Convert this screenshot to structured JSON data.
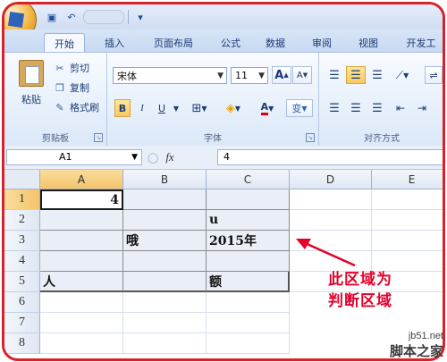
{
  "tabs": [
    "开始",
    "插入",
    "页面布局",
    "公式",
    "数据",
    "审阅",
    "视图",
    "开发工"
  ],
  "clipboard": {
    "paste": "粘贴",
    "cut": "剪切",
    "copy": "复制",
    "format_painter": "格式刷",
    "group_label": "剪贴板"
  },
  "font": {
    "name": "宋体",
    "size": "11",
    "grow": "A",
    "shrink": "A",
    "bold": "B",
    "italic": "I",
    "underline": "U",
    "font_color_glyph": "A",
    "phonetic": "变",
    "group_label": "字体"
  },
  "alignment": {
    "group_label": "对齐方式"
  },
  "formula_bar": {
    "name_box": "A1",
    "fx": "fx",
    "value": "4"
  },
  "columns": [
    "A",
    "B",
    "C",
    "D",
    "E"
  ],
  "rows": [
    "1",
    "2",
    "3",
    "4",
    "5",
    "6",
    "7",
    "8"
  ],
  "cells": {
    "A1": "4",
    "C2": "u",
    "B3": "哦",
    "C3": "2015年",
    "A5": "人",
    "C5": "额"
  },
  "annotation": {
    "line1": "此区域为",
    "line2": "判断区域",
    "color": "#e4002b"
  },
  "watermark": {
    "url": "jb51.net",
    "name": "脚本之家"
  }
}
